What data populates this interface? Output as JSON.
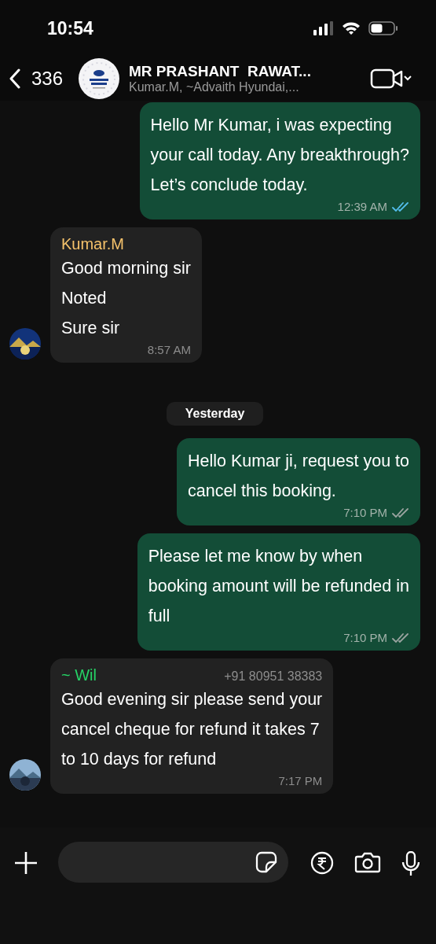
{
  "status_bar": {
    "time": "10:54"
  },
  "header": {
    "back_count": "336",
    "title": "MR PRASHANT  RAWAT...",
    "subtitle": "Kumar.M, ~Advaith Hyundai,..."
  },
  "messages": [
    {
      "kind": "outgoing",
      "lines": [
        "Hello Mr Kumar, i was expecting",
        "your call today. Any breakthrough?",
        "Let’s conclude today."
      ],
      "time": "12:39 AM",
      "read": true
    },
    {
      "kind": "incoming",
      "sender": "Kumar.M",
      "color": "#f5c26b",
      "lines": [
        "Good morning sir",
        "Noted",
        "Sure sir"
      ],
      "time": "8:57 AM"
    },
    {
      "kind": "date",
      "label": "Yesterday"
    },
    {
      "kind": "outgoing",
      "lines": [
        "Hello Kumar ji, request you to",
        "cancel this booking."
      ],
      "time": "7:10 PM",
      "read": false
    },
    {
      "kind": "outgoing",
      "lines": [
        "Please let me know by when",
        "booking amount will be refunded in",
        "full"
      ],
      "time": "7:10 PM",
      "read": false
    },
    {
      "kind": "incoming",
      "sender": "~ Wil",
      "color": "#25d366",
      "phone": "+91 80951 38383",
      "lines": [
        "Good evening sir please send your",
        "cancel cheque for refund it takes 7",
        "to 10 days for refund"
      ],
      "time": "7:17 PM"
    }
  ]
}
